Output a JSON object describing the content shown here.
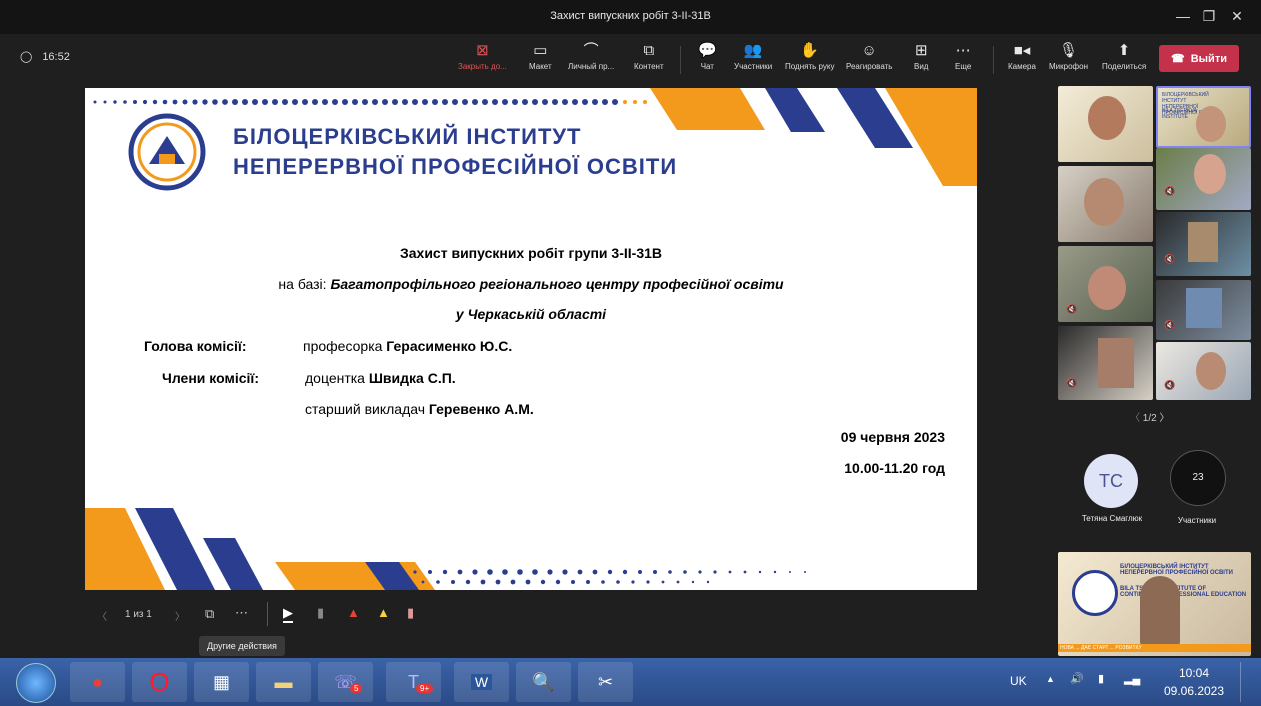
{
  "window": {
    "title": "Захист випускних робіт 3-ІІ-31В"
  },
  "toolbar": {
    "timer": "16:52",
    "close_app": "Закрыть до...",
    "layout": "Макет",
    "personal": "Личный пр...",
    "content": "Контент",
    "chat": "Чат",
    "participants": "Участники",
    "raise_hand": "Поднять руку",
    "react": "Реагировать",
    "view": "Вид",
    "more": "Еще",
    "camera": "Камера",
    "mic": "Микрофон",
    "share": "Поделиться",
    "leave": "Выйти"
  },
  "slide": {
    "institute_line1": "БІЛОЦЕРКІВСЬКИЙ ІНСТИТУТ",
    "institute_line2": "НЕПЕРЕРВНОЇ ПРОФЕСІЙНОЇ ОСВІТИ",
    "heading": "Захист випускних робіт групи 3-ІІ-31В",
    "base_prefix": "на базі: ",
    "base_name": "Багатопрофільного регіонального центру професійної освіти",
    "region": "у Черкаській області",
    "chair_label": "Голова комісії:",
    "chair_role": "професорка ",
    "chair_name": "Герасименко Ю.С.",
    "members_label": "Члени комісії:",
    "member1_role": "доцентка ",
    "member1_name": "Швидка С.П.",
    "member2_role": "старший викладач ",
    "member2_name": "Геревенко А.М.",
    "date": "09 червня 2023",
    "time": "10.00-11.20 год"
  },
  "slide_controls": {
    "page": "1 из 1",
    "more_tooltip": "Другие действия"
  },
  "gallery": {
    "pager": "1/2",
    "tile_logo_text": "БІЛОЦЕРКІВСЬКИЙ ІНСТИТУТ НЕПЕРЕРВНОЇ ПРОФЕСІЙНОЇ ОСВІТИ",
    "tile_logo_text_en": "BILA TSERKVA INSTITUTE",
    "avatar_initials": "TC",
    "avatar_name": "Тетяна Смаглюк",
    "participants_count": "23",
    "participants_label": "Участники",
    "speaker_logo": "БІЛОЦЕРКІВСЬКИЙ ІНСТИТУТ НЕПЕРЕРВНОЇ ПРОФЕСІЙНОЇ ОСВІТИ",
    "speaker_logo_en": "BILA TSERKVA INSTITUTE OF CONTINUOUS PROFESSIONAL EDUCATION",
    "speaker_banner": "НОВА ... ДАЄ СТАРТ ... РОЗВИТКУ"
  },
  "taskbar": {
    "lang": "UK",
    "clock_time": "10:04",
    "clock_date": "09.06.2023",
    "viber_badge": "5",
    "teams_badge": "9+"
  },
  "colors": {
    "accent_red": "#c4314b",
    "slide_blue": "#2b3d8f",
    "slide_orange": "#f39a1c"
  }
}
